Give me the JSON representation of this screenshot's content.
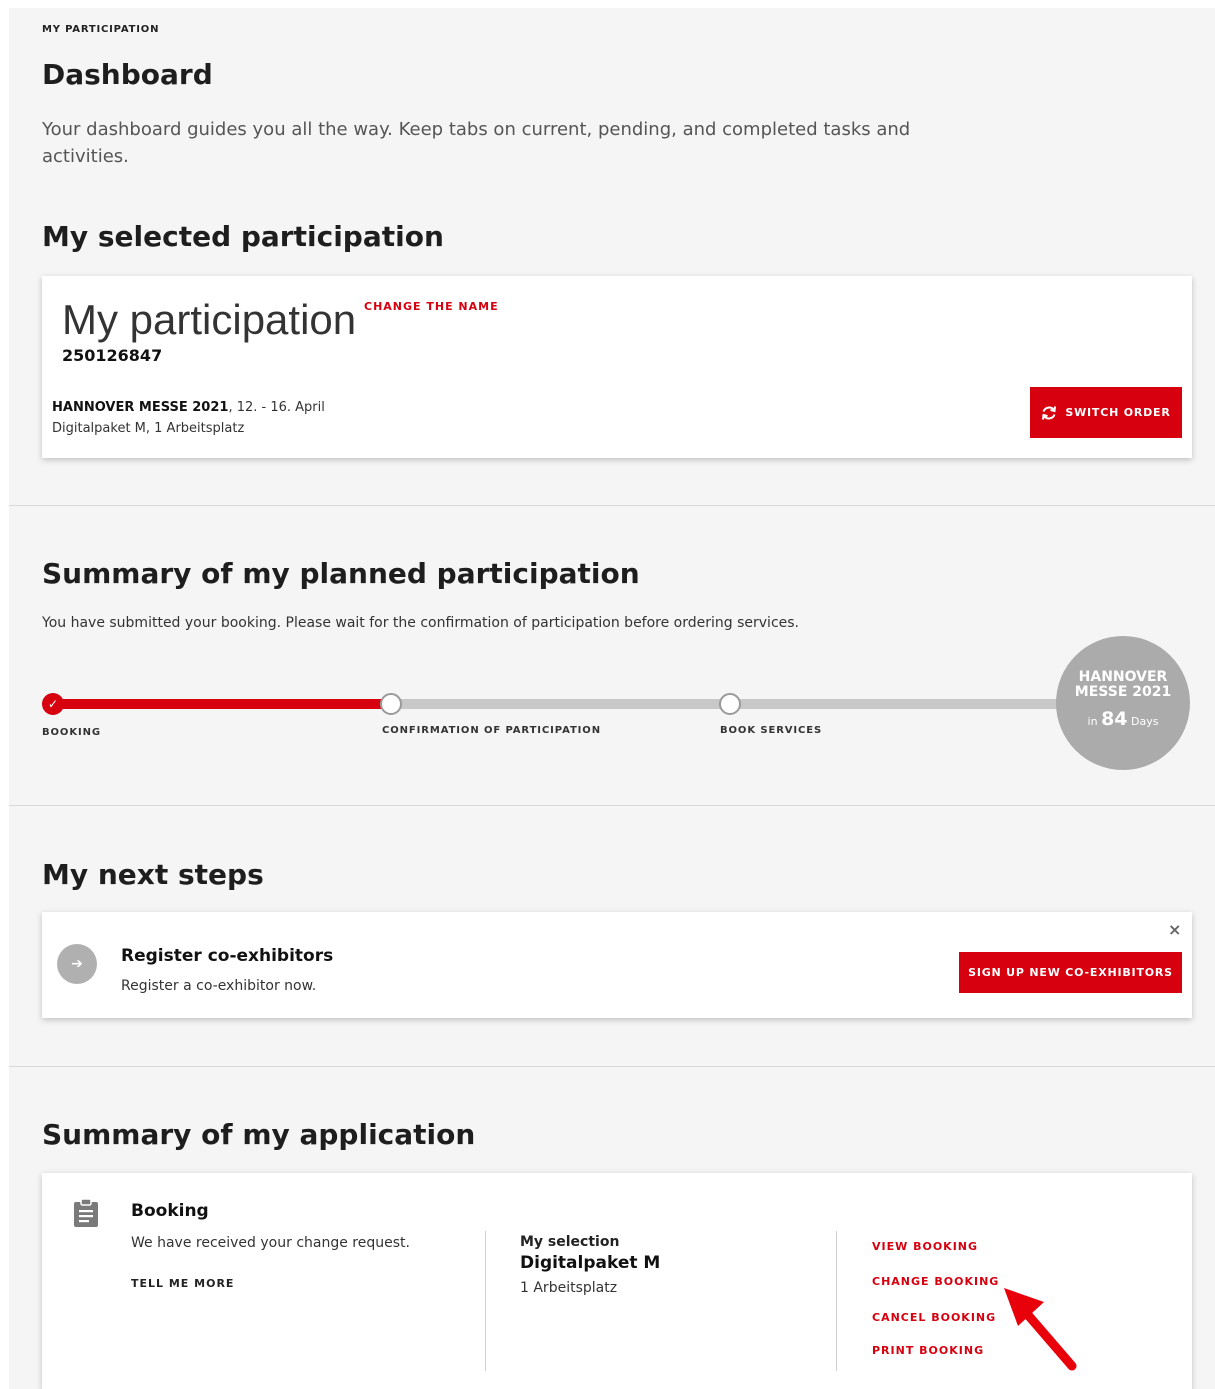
{
  "header": {
    "eyebrow": "MY PARTICIPATION",
    "title": "Dashboard",
    "intro": "Your dashboard guides you all the way. Keep tabs on current, pending, and completed tasks and activities."
  },
  "selected": {
    "heading": "My selected participation",
    "name": "My participation",
    "change_name_label": "CHANGE THE NAME",
    "number": "250126847",
    "event_name": "HANNOVER MESSE 2021",
    "event_dates": ", 12. - 16. April",
    "package": "Digitalpaket M, 1 Arbeitsplatz",
    "switch_label": "SWITCH ORDER",
    "switch_icon": "refresh-icon"
  },
  "summary": {
    "heading": "Summary of my planned participation",
    "text": "You have submitted your booking. Please wait for the confirmation of participation before ordering services.",
    "steps": [
      {
        "label": "BOOKING",
        "done": true
      },
      {
        "label": "CONFIRMATION OF PARTICIPATION",
        "done": false
      },
      {
        "label": "BOOK SERVICES",
        "done": false
      }
    ],
    "countdown": {
      "event_line1": "HANNOVER",
      "event_line2": "MESSE 2021",
      "prefix": "in",
      "days": "84",
      "suffix": "Days"
    }
  },
  "next_steps": {
    "heading": "My next steps",
    "item_title": "Register co-exhibitors",
    "item_text": "Register a co-exhibitor now.",
    "button_label": "SIGN UP NEW CO-EXHIBITORS",
    "close_symbol": "×",
    "item_icon": "arrow-right-icon"
  },
  "application": {
    "heading": "Summary of my application",
    "section_title": "Booking",
    "section_text": "We have received your change request.",
    "tell_more_label": "TELL ME MORE",
    "selection_label": "My selection",
    "selection_name": "Digitalpaket M",
    "selection_detail": "1 Arbeitsplatz",
    "actions": [
      "VIEW BOOKING",
      "CHANGE BOOKING",
      "CANCEL BOOKING",
      "PRINT BOOKING"
    ],
    "section_icon": "clipboard-icon"
  },
  "colors": {
    "accent": "#d6000f",
    "annotation_arrow": "#e8000b"
  }
}
